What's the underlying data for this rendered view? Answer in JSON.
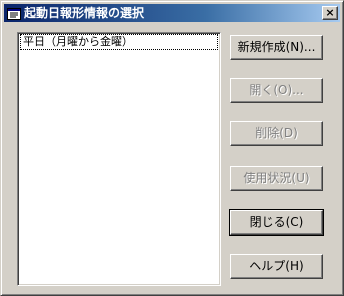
{
  "window": {
    "title": "起動日報形情報の選択",
    "close_label": "×"
  },
  "list": {
    "items": [
      {
        "label": "平日（月曜から金曜）",
        "selected": true
      }
    ]
  },
  "buttons": {
    "new": {
      "label": "新規作成(N)...",
      "enabled": true
    },
    "open": {
      "label": "開く(O)...",
      "enabled": false
    },
    "delete": {
      "label": "削除(D)",
      "enabled": false
    },
    "usage": {
      "label": "使用状況(U)",
      "enabled": false
    },
    "close": {
      "label": "閉じる(C)",
      "enabled": true
    },
    "help": {
      "label": "ヘルプ(H)",
      "enabled": true
    }
  }
}
